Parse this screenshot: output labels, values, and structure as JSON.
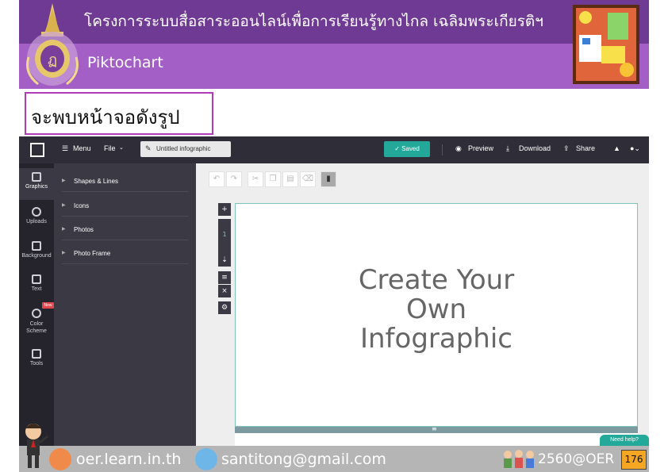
{
  "banner": {
    "title": "โครงการระบบสื่อสาระออนไลน์เพื่อการเรียนรู้ทางไกล เฉลิมพระเกียรติฯ",
    "subtitle": "Piktochart"
  },
  "caption": "จะพบหน้าจอดังรูป",
  "app": {
    "menu_label": "Menu",
    "file_label": "File",
    "doc_title": "Untitled infographic",
    "saved_label": "Saved",
    "preview_label": "Preview",
    "download_label": "Download",
    "share_label": "Share",
    "rail": [
      {
        "label": "Graphics"
      },
      {
        "label": "Uploads"
      },
      {
        "label": "Background"
      },
      {
        "label": "Text"
      },
      {
        "label": "Color Scheme"
      },
      {
        "label": "Tools"
      }
    ],
    "new_badge": "New",
    "panel_items": [
      "Shapes & Lines",
      "Icons",
      "Photos",
      "Photo Frame"
    ],
    "canvas_lines": [
      "Create Your",
      "Own",
      "Infographic"
    ],
    "page_indicator": "1",
    "help_label": "Need help?"
  },
  "footer": {
    "site": "oer.learn.in.th",
    "email": "santitong@gmail.com",
    "tag": "2560@OER",
    "page_number": "176"
  },
  "colors": {
    "banner_dark": "#6f3a93",
    "banner_light": "#a45fc6",
    "accent_teal": "#22a99a",
    "app_dark": "#2f2e38"
  }
}
